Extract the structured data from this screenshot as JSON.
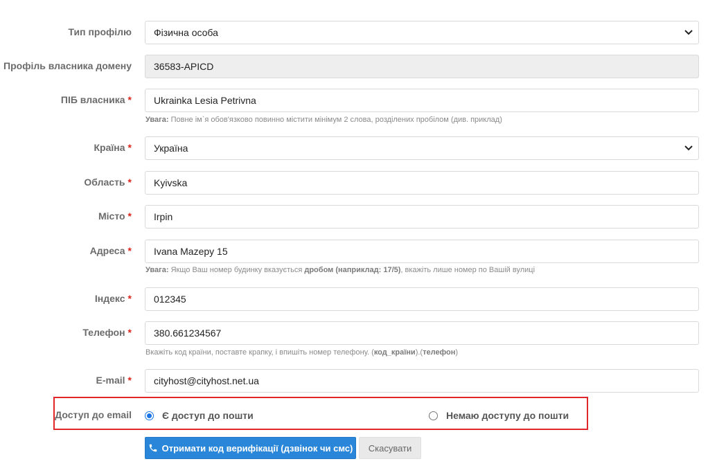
{
  "form": {
    "profile_type": {
      "label": "Тип профілю",
      "value": "Фізична особа"
    },
    "owner_profile": {
      "label": "Профіль власника домену",
      "value": "36583-APICD"
    },
    "full_name": {
      "label": "ПІБ власника",
      "required": "*",
      "value": "Ukrainka Lesia Petrivna",
      "hint_strong": "Увага:",
      "hint_text": " Повне ім`я обов'язково повинно містити мінімум 2 слова, розділених пробілом (див. приклад)"
    },
    "country": {
      "label": "Країна",
      "required": "*",
      "value": "Україна"
    },
    "region": {
      "label": "Область",
      "required": "*",
      "value": "Kyivska"
    },
    "city": {
      "label": "Місто",
      "required": "*",
      "value": "Irpin"
    },
    "address": {
      "label": "Адреса",
      "required": "*",
      "value": "Ivana Mazepy 15",
      "hint_strong": "Увага:",
      "hint_text_1": " Якщо Ваш номер будинку вказується ",
      "hint_strong_2": "дробом (наприклад: 17/5)",
      "hint_text_2": ", вкажіть лише номер по Вашій вулиці"
    },
    "postcode": {
      "label": "Індекс",
      "required": "*",
      "value": "012345"
    },
    "phone": {
      "label": "Телефон",
      "required": "*",
      "value": "380.661234567",
      "hint_text_1": "Вкажіть код країни, поставте крапку, і впишіть номер телефону. (",
      "hint_strong_1": "код_країни",
      "hint_text_2": ").(",
      "hint_strong_2": "телефон",
      "hint_text_3": ")"
    },
    "email": {
      "label": "E-mail",
      "required": "*",
      "value": "cityhost@cityhost.net.ua"
    },
    "email_access": {
      "label": "Доступ до email",
      "option_yes": "Є доступ до пошти",
      "option_no": "Немаю доступу до пошти",
      "selected": "yes"
    }
  },
  "actions": {
    "verify_label": "Отримати код верифікації (дзвінок чи смс)",
    "cancel_label": "Скасувати"
  },
  "colors": {
    "primary": "#2a86d8",
    "required": "#d9261c",
    "highlight": "#e0262b",
    "radio": "#1a73e8"
  },
  "icons": {
    "select_chevron": "chevron-down-icon",
    "verify": "phone-icon"
  }
}
